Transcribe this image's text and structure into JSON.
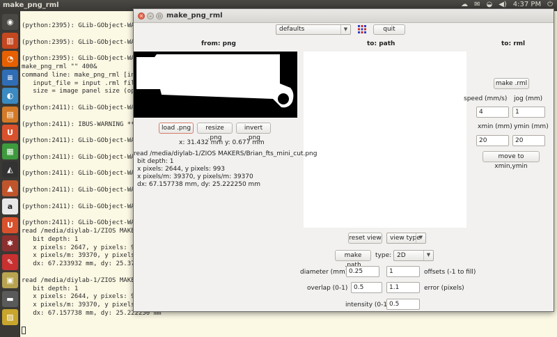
{
  "topbar": {
    "title": "make_png_rml",
    "time": "4:37 PM"
  },
  "launcher": {
    "items": [
      {
        "name": "ubuntu-home-icon",
        "color": "#4a4844",
        "glyph": "◉"
      },
      {
        "name": "trash-bin-icon",
        "color": "#c5471f",
        "glyph": "▥"
      },
      {
        "name": "firefox-icon",
        "color": "#e66000",
        "glyph": "◔"
      },
      {
        "name": "writer-icon",
        "color": "#2f6db5",
        "glyph": "≡"
      },
      {
        "name": "chromium-icon",
        "color": "#3b8ac2",
        "glyph": "◐"
      },
      {
        "name": "software-center-icon",
        "color": "#d47a27",
        "glyph": "▤"
      },
      {
        "name": "ubuntu-one-icon",
        "color": "#d9512c",
        "glyph": "U"
      },
      {
        "name": "calc-icon",
        "color": "#3d9a3d",
        "glyph": "▦"
      },
      {
        "name": "inkscape-icon",
        "color": "#333333",
        "glyph": "◭"
      },
      {
        "name": "impress-icon",
        "color": "#c0552b",
        "glyph": "▲"
      },
      {
        "name": "amazon-icon",
        "color": "#e8e8e8",
        "glyph": "a"
      },
      {
        "name": "ubuntu-one-music-icon",
        "color": "#d9512c",
        "glyph": "U"
      },
      {
        "name": "settings-icon",
        "color": "#8c2f2f",
        "glyph": "✱"
      },
      {
        "name": "pin-tool-icon",
        "color": "#c93030",
        "glyph": "✎"
      },
      {
        "name": "files-icon",
        "color": "#b8a450",
        "glyph": "▣"
      },
      {
        "name": "terminal-icon",
        "color": "#5a5a5a",
        "glyph": "▬"
      },
      {
        "name": "workspace-icon",
        "color": "#c8a52c",
        "glyph": "▨"
      }
    ]
  },
  "terminal": {
    "lines": [
      "(python:2395): GLib-GObject-WAR",
      "",
      "(python:2395): GLib-GObject-WAR",
      "",
      "(python:2395): GLib-GObject-WAR",
      "make_png_rml \"\" 400&",
      "command line: make_png_rml [inp",
      "   input_file = input .rml file",
      "   size = image panel size (opt",
      "",
      "(python:2411): GLib-GObject-WAR",
      "",
      "(python:2411): IBUS-WARNING **",
      "",
      "(python:2411): GLib-GObject-WAR",
      "",
      "(python:2411): GLib-GObject-WAR",
      "",
      "(python:2411): GLib-GObject-WAR",
      "",
      "(python:2411): GLib-GObject-WAR",
      "",
      "(python:2411): GLib-GObject-WAR",
      "",
      "(python:2411): GLib-GObject-WAR",
      "read /media/diylab-1/ZIOS MAKER",
      "   bit depth: 1",
      "   x pixels: 2647, y pixels: 99",
      "   x pixels/m: 39370, y pixels/",
      "   dx: 67.233932 mm, dy: 25.374",
      "",
      "read /media/diylab-1/ZIOS MAKER",
      "   bit depth: 1",
      "   x pixels: 2644, y pixels: 99",
      "   x pixels/m: 39370, y pixels/",
      "   dx: 67.157738 mm, dy: 25.222250 mm"
    ]
  },
  "window": {
    "title": "make_png_rml",
    "defaults_value": "defaults",
    "quit_label": "quit",
    "from_png_header": "from: png",
    "to_path_header": "to: path",
    "to_rml_header": "to: rml",
    "load_png_label": "load .png",
    "resize_png_label": "resize .png",
    "invert_png_label": "invert .png",
    "coords": "x: 31.432 mm  y: 0.677 mm",
    "info_lines": [
      "read /media/diylab-1/ZIOS MAKERS/Brian_fts_mini_cut.png",
      "bit depth: 1",
      "x pixels: 2644, y pixels: 993",
      "x pixels/m: 39370, y pixels/m: 39370",
      "dx: 67.157738 mm, dy: 25.222250 mm"
    ],
    "make_rml_label": "make .rml",
    "speed_label": "speed (mm/s)",
    "jog_label": "jog (mm)",
    "speed_value": "4",
    "jog_value": "1",
    "xmin_label": "xmin (mm)",
    "ymin_label": "ymin (mm)",
    "xmin_value": "20",
    "ymin_value": "20",
    "move_label": "move to xmin,ymin",
    "reset_view_label": "reset view",
    "view_type_value": "view type",
    "make_path_label": "make .path",
    "type_label": "type:",
    "type_value": "2D",
    "diameter_label": "diameter (mm)",
    "diameter_value": "0.25",
    "offsets_value": "1",
    "offsets_label": "offsets (-1 to fill)",
    "overlap_label": "overlap (0-1)",
    "overlap_value": "0.5",
    "error_value": "1.1",
    "error_label": "error (pixels)",
    "intensity_label": "intensity (0-1)",
    "intensity_value": "0.5"
  }
}
